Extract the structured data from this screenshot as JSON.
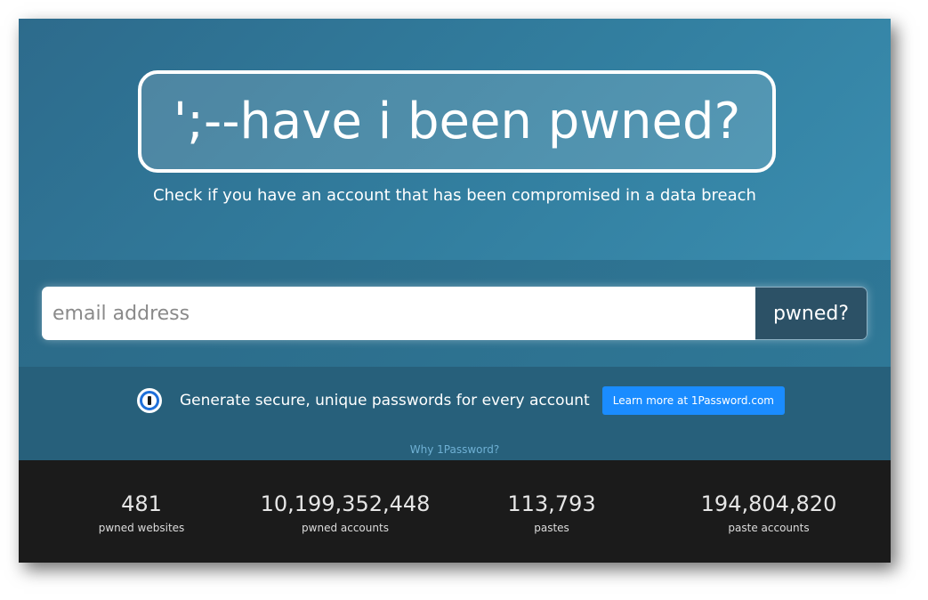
{
  "hero": {
    "logo_text": "';--have i been pwned?",
    "tagline": "Check if you have an account that has been compromised in a data breach"
  },
  "search": {
    "placeholder": "email address",
    "button_label": "pwned?"
  },
  "promo": {
    "icon": "1password-icon",
    "text": "Generate secure, unique passwords for every account",
    "button_label": "Learn more at 1Password.com",
    "link_text": "Why 1Password?"
  },
  "stats": [
    {
      "value": "481",
      "label": "pwned websites"
    },
    {
      "value": "10,199,352,448",
      "label": "pwned accounts"
    },
    {
      "value": "113,793",
      "label": "pastes"
    },
    {
      "value": "194,804,820",
      "label": "paste accounts"
    }
  ],
  "colors": {
    "hero_bg": "#327e9f",
    "button_dark": "#2c5166",
    "promo_bg": "#27607b",
    "promo_button": "#1a8cff",
    "stats_bg": "#1b1b1b"
  }
}
